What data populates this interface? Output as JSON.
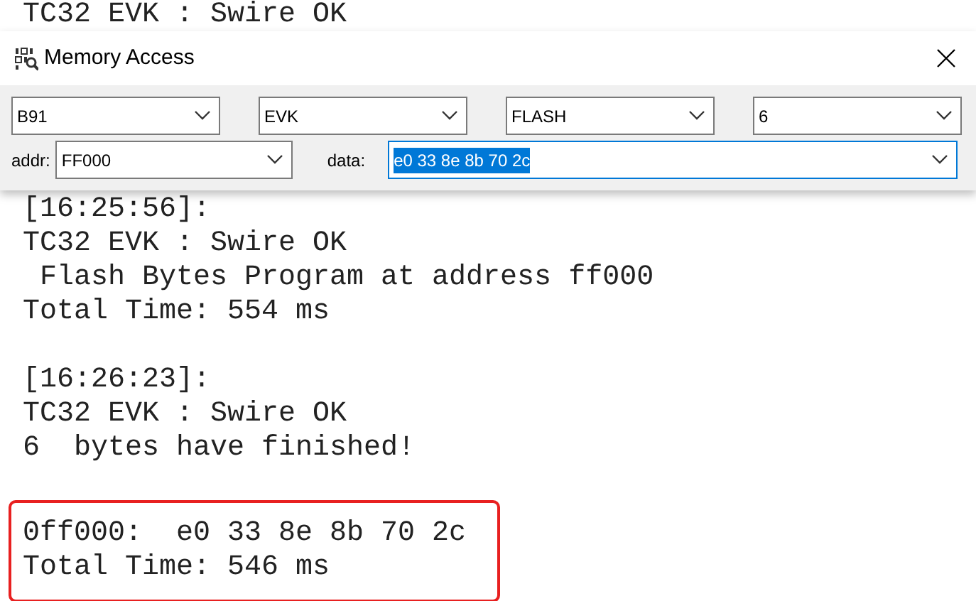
{
  "log_cut_line": "TC32 EVK : Swire OK",
  "dialog": {
    "title": "Memory Access",
    "selectors": [
      {
        "value": "B91"
      },
      {
        "value": "EVK"
      },
      {
        "value": "FLASH"
      },
      {
        "value": "6"
      }
    ],
    "addr": {
      "label": "addr:",
      "value": "FF000"
    },
    "data": {
      "label": "data:",
      "value": "e0 33 8e 8b 70 2c",
      "selected": true
    }
  },
  "log": [
    {
      "lines": [
        "[16:25:56]:",
        "TC32 EVK : Swire OK",
        " Flash Bytes Program at address ff000",
        "Total Time: 554 ms"
      ],
      "highlighted": false
    },
    {
      "lines": [
        "[16:26:23]:",
        "TC32 EVK : Swire OK",
        "6  bytes have finished!"
      ],
      "highlighted": false
    },
    {
      "lines": [
        "0ff000:  e0 33 8e 8b 70 2c",
        "Total Time: 546 ms"
      ],
      "highlighted": true
    }
  ]
}
